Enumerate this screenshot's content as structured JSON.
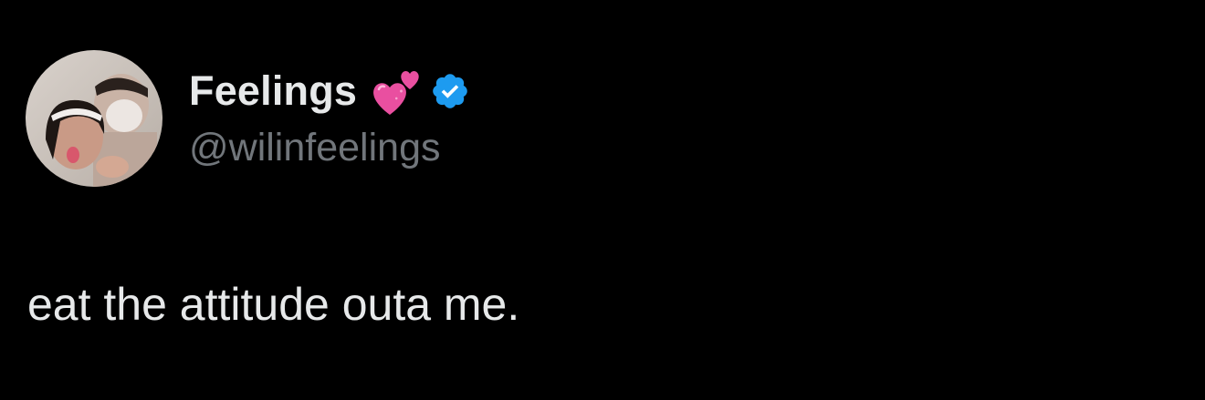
{
  "author": {
    "display_name": "Feelings",
    "handle": "@wilinfeelings",
    "name_emoji": "two-hearts-icon",
    "verified": true,
    "verified_color": "#1d9bf0"
  },
  "tweet": {
    "text": "eat the attitude outa me."
  },
  "colors": {
    "background": "#000000",
    "primary_text": "#e7e9ea",
    "secondary_text": "#71767b",
    "heart": "#e94fa0"
  }
}
